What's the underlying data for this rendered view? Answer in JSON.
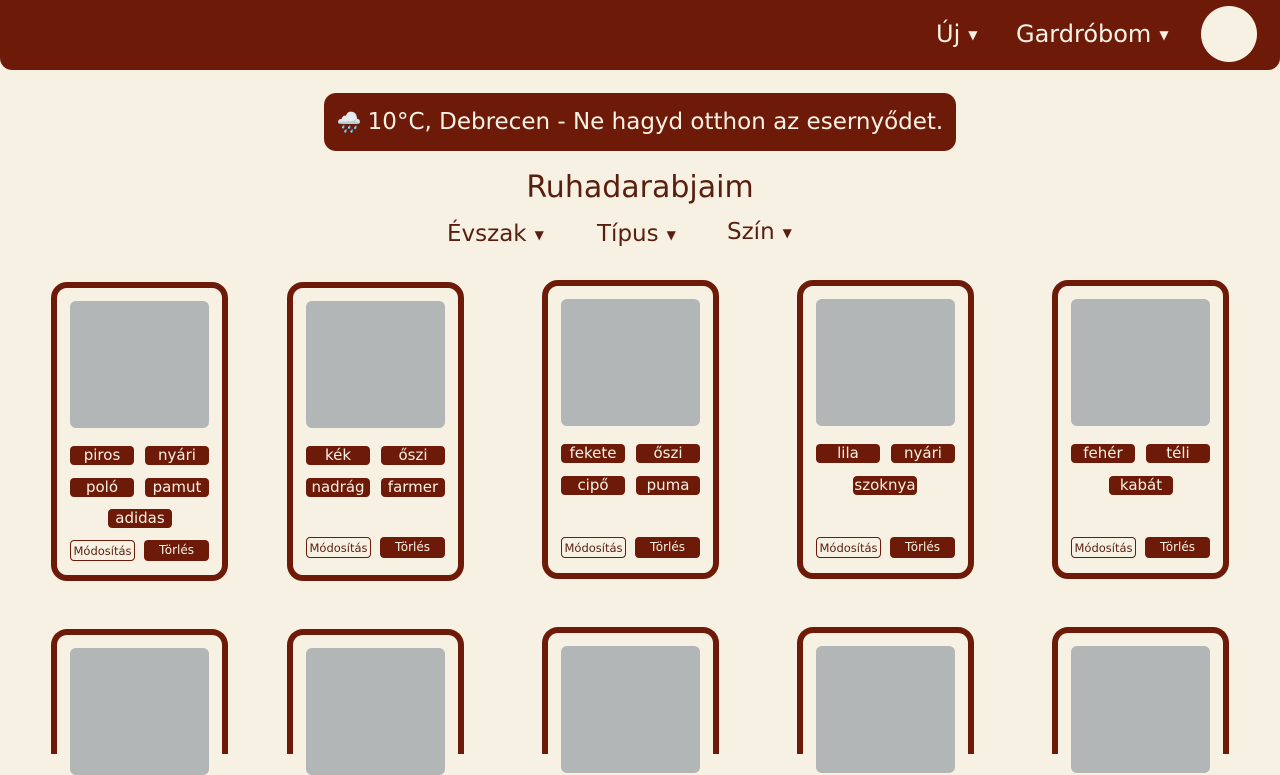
{
  "nav": {
    "new_label": "Új",
    "wardrobe_label": "Gardróbom"
  },
  "weather": {
    "icon": "🌧️",
    "text": "10°C, Debrecen - Ne hagyd otthon az esernyődet."
  },
  "page_title": "Ruhadarabjaim",
  "filters": {
    "season": "Évszak",
    "type": "Típus",
    "color": "Szín"
  },
  "card_actions": {
    "edit": "Módosítás",
    "delete": "Törlés"
  },
  "cards": [
    {
      "tags": [
        "piros",
        "nyári",
        "poló",
        "pamut",
        "adidas"
      ]
    },
    {
      "tags": [
        "kék",
        "őszi",
        "nadrág",
        "farmer"
      ]
    },
    {
      "tags": [
        "fekete",
        "őszi",
        "cipő",
        "puma"
      ]
    },
    {
      "tags": [
        "lila",
        "nyári",
        "szoknya"
      ]
    },
    {
      "tags": [
        "fehér",
        "téli",
        "kabát"
      ]
    }
  ],
  "colors": {
    "primary": "#6e1a08",
    "background": "#f6f1e3",
    "image_placeholder": "#b3b6b6"
  }
}
